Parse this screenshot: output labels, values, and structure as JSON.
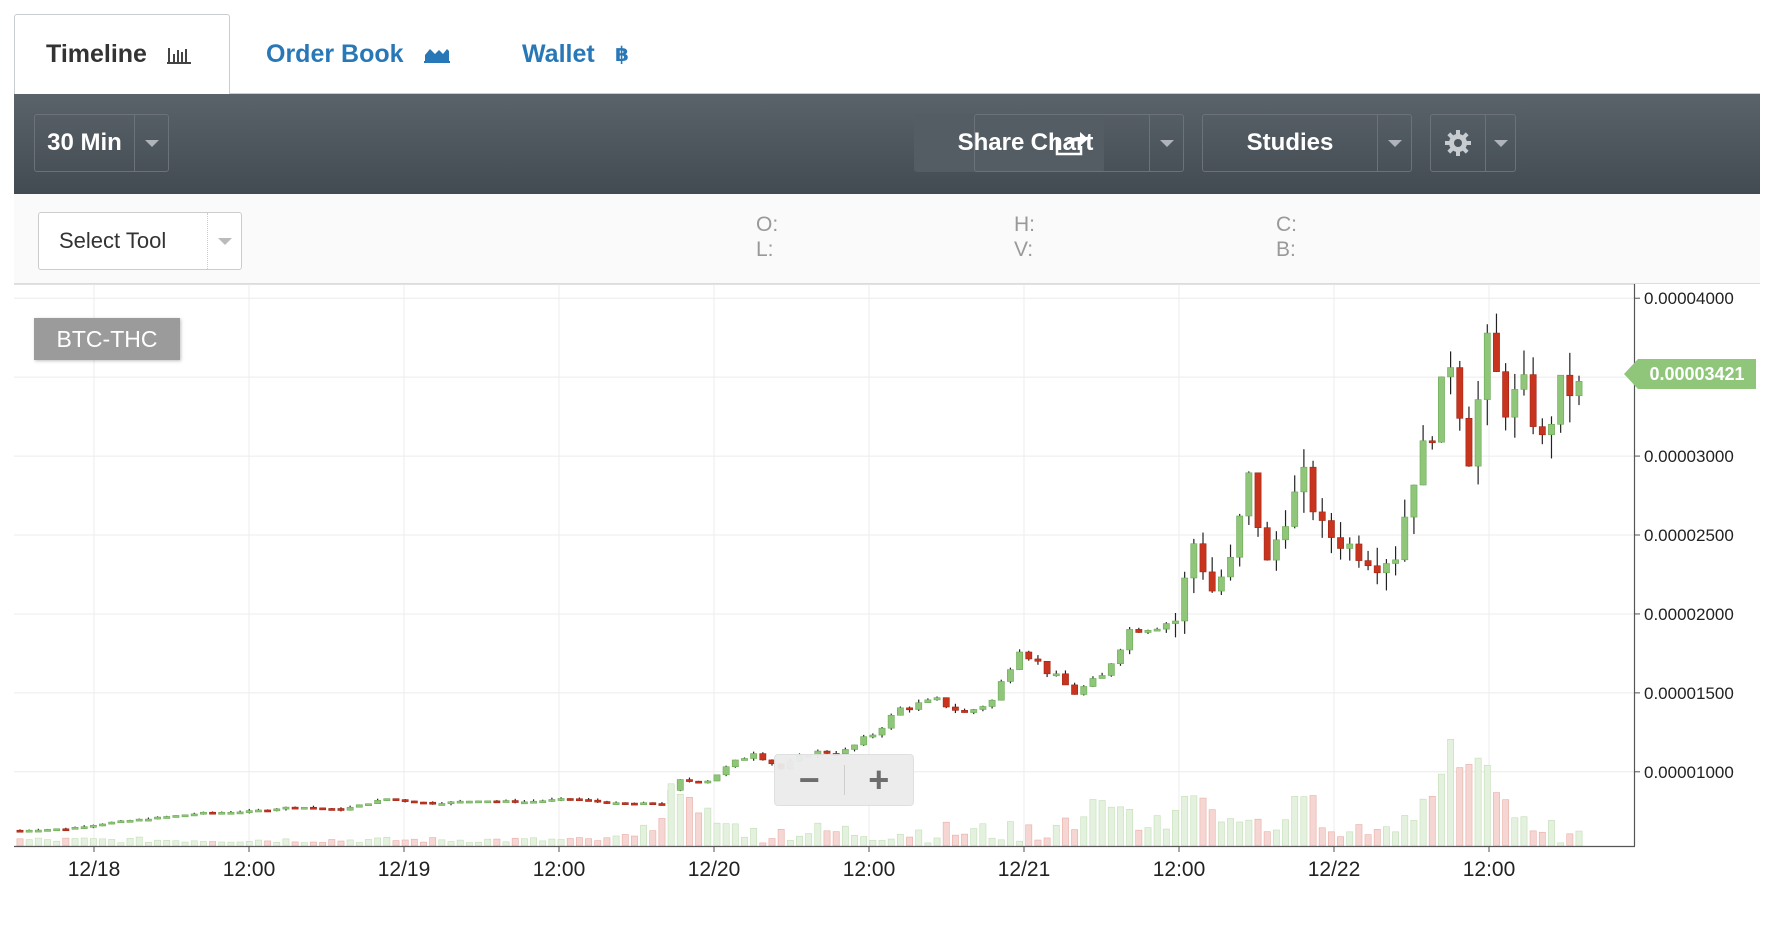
{
  "tabs": [
    {
      "label": "Timeline",
      "icon": "bar-chart-icon",
      "active": true
    },
    {
      "label": "Order Book",
      "icon": "area-chart-icon",
      "active": false
    },
    {
      "label": "Wallet",
      "icon": "bitcoin-icon",
      "active": false
    }
  ],
  "toolbar": {
    "interval": "30 Min",
    "share": "Share",
    "chart": "Chart",
    "studies": "Studies",
    "settings_icon": "gear-icon"
  },
  "tools": {
    "select_tool": "Select Tool",
    "ohlc": {
      "open": "O:",
      "high": "H:",
      "close": "C:",
      "low": "L:",
      "volume": "V:",
      "b": "B:"
    }
  },
  "chart": {
    "pair": "BTC-THC",
    "current_price": "0.00003421",
    "zoom_out": "−",
    "zoom_in": "+"
  },
  "colors": {
    "up": "#8fc67a",
    "down": "#c9341f",
    "accent": "#2878b8",
    "toolbar": "#4d555c"
  },
  "chart_data": {
    "type": "candlestick",
    "title": "",
    "x_ticks": [
      "12/18",
      "12:00",
      "12/19",
      "12:00",
      "12/20",
      "12:00",
      "12/21",
      "12:00",
      "12/22",
      "12:00"
    ],
    "y_ticks": [
      "0.00004000",
      "0.00003000",
      "0.00002500",
      "0.00002000",
      "0.00001500",
      "0.00001000"
    ],
    "ylim": [
      5.3e-06,
      4.09e-05
    ],
    "grid": true,
    "close_series_anchors": [
      [
        0,
        6.3e-06
      ],
      [
        5,
        6.4e-06
      ],
      [
        10,
        6.8e-06
      ],
      [
        15,
        7.1e-06
      ],
      [
        20,
        7.4e-06
      ],
      [
        25,
        7.5e-06
      ],
      [
        30,
        7.8e-06
      ],
      [
        35,
        7.6e-06
      ],
      [
        40,
        8.3e-06
      ],
      [
        45,
        8e-06
      ],
      [
        50,
        8.2e-06
      ],
      [
        55,
        8.1e-06
      ],
      [
        60,
        8.3e-06
      ],
      [
        65,
        8e-06
      ],
      [
        70,
        8e-06
      ],
      [
        72,
        9.4e-06
      ],
      [
        75,
        9.5e-06
      ],
      [
        78,
        1.06e-05
      ],
      [
        80,
        1.13e-05
      ],
      [
        83,
        1.02e-05
      ],
      [
        86,
        1.12e-05
      ],
      [
        90,
        1.13e-05
      ],
      [
        93,
        1.24e-05
      ],
      [
        96,
        1.4e-05
      ],
      [
        100,
        1.45e-05
      ],
      [
        103,
        1.37e-05
      ],
      [
        106,
        1.45e-05
      ],
      [
        109,
        1.79e-05
      ],
      [
        112,
        1.64e-05
      ],
      [
        115,
        1.5e-05
      ],
      [
        118,
        1.6e-05
      ],
      [
        121,
        1.9e-05
      ],
      [
        124,
        1.93e-05
      ],
      [
        126,
        1.96e-05
      ],
      [
        128,
        2.45e-05
      ],
      [
        130,
        2.15e-05
      ],
      [
        132,
        2.32e-05
      ],
      [
        134,
        2.85e-05
      ],
      [
        136,
        2.31e-05
      ],
      [
        138,
        2.63e-05
      ],
      [
        140,
        2.85e-05
      ],
      [
        142,
        2.53e-05
      ],
      [
        145,
        2.43e-05
      ],
      [
        148,
        2.33e-05
      ],
      [
        150,
        2.38e-05
      ],
      [
        152,
        2.88e-05
      ],
      [
        154,
        3.18e-05
      ],
      [
        156,
        3.62e-05
      ],
      [
        158,
        3.01e-05
      ],
      [
        160,
        3.68e-05
      ],
      [
        162,
        3.32e-05
      ],
      [
        164,
        3.42e-05
      ],
      [
        166,
        3.08e-05
      ],
      [
        168,
        3.42e-05
      ],
      [
        170,
        3.42e-05
      ]
    ],
    "volume_spikes": [
      [
        72,
        0.55
      ],
      [
        118,
        0.35
      ],
      [
        128,
        0.4
      ],
      [
        140,
        0.35
      ],
      [
        156,
        1.0
      ],
      [
        160,
        0.5
      ]
    ]
  }
}
